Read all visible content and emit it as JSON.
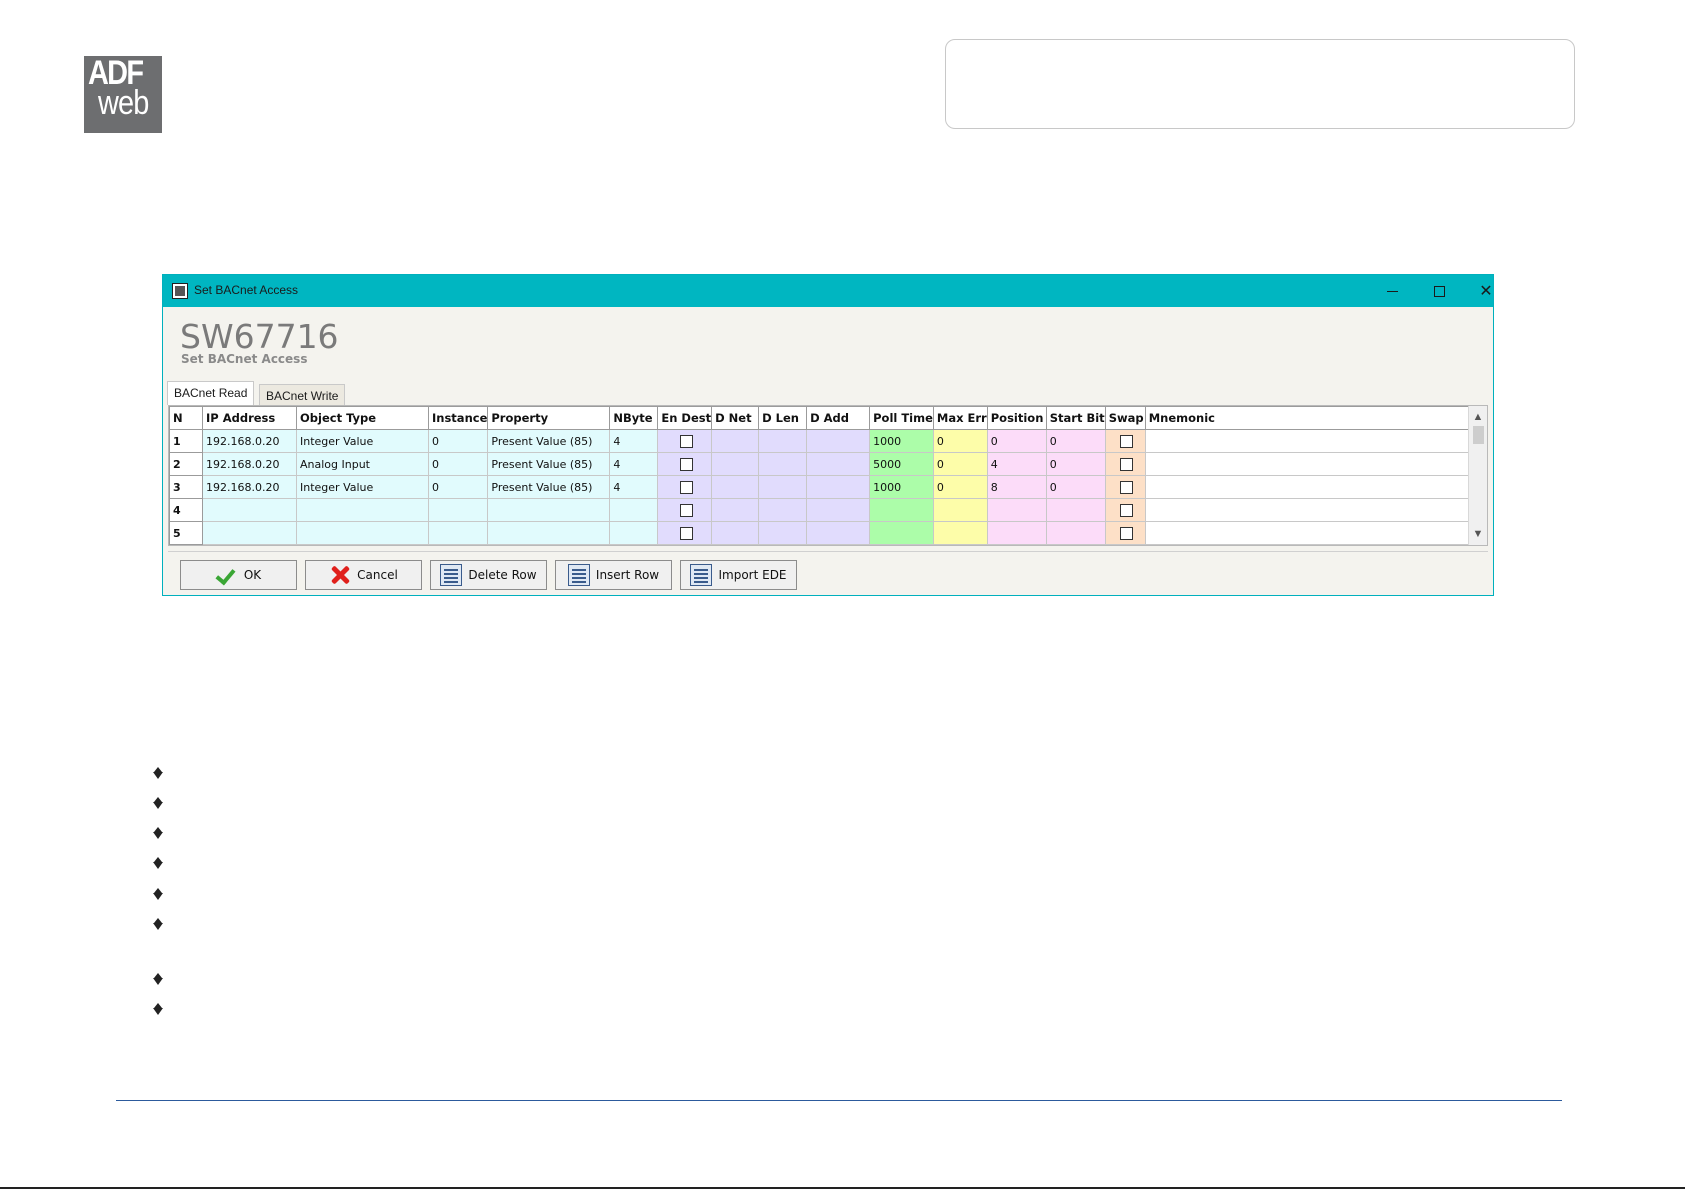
{
  "logo": {
    "top": "ADF",
    "bottom": "web"
  },
  "window": {
    "title": "Set BACnet Access",
    "heading": "SW67716",
    "subheading": "Set BACnet Access",
    "tabs": [
      "BACnet Read",
      "BACnet Write"
    ],
    "columns": [
      "N",
      "IP Address",
      "Object Type",
      "Instance",
      "Property",
      "NByte",
      "En Dest",
      "D Net",
      "D Len",
      "D Add",
      "Poll Time",
      "Max Err",
      "Position",
      "Start Bit",
      "Swap",
      "Mnemonic"
    ],
    "rows": [
      {
        "n": "1",
        "ip": "192.168.0.20",
        "object_type": "Integer Value",
        "instance": "0",
        "property": "Present Value (85)",
        "nbyte": "4",
        "d_net": "",
        "d_len": "",
        "d_add": "",
        "poll_time": "1000",
        "max_err": "0",
        "position": "0",
        "start_bit": "0",
        "mnemonic": ""
      },
      {
        "n": "2",
        "ip": "192.168.0.20",
        "object_type": "Analog Input",
        "instance": "0",
        "property": "Present Value (85)",
        "nbyte": "4",
        "d_net": "",
        "d_len": "",
        "d_add": "",
        "poll_time": "5000",
        "max_err": "0",
        "position": "4",
        "start_bit": "0",
        "mnemonic": ""
      },
      {
        "n": "3",
        "ip": "192.168.0.20",
        "object_type": "Integer Value",
        "instance": "0",
        "property": "Present Value (85)",
        "nbyte": "4",
        "d_net": "",
        "d_len": "",
        "d_add": "",
        "poll_time": "1000",
        "max_err": "0",
        "position": "8",
        "start_bit": "0",
        "mnemonic": ""
      },
      {
        "n": "4",
        "ip": "",
        "object_type": "",
        "instance": "",
        "property": "",
        "nbyte": "",
        "d_net": "",
        "d_len": "",
        "d_add": "",
        "poll_time": "",
        "max_err": "",
        "position": "",
        "start_bit": "",
        "mnemonic": ""
      },
      {
        "n": "5",
        "ip": "",
        "object_type": "",
        "instance": "",
        "property": "",
        "nbyte": "",
        "d_net": "",
        "d_len": "",
        "d_add": "",
        "poll_time": "",
        "max_err": "",
        "position": "",
        "start_bit": "",
        "mnemonic": ""
      }
    ],
    "buttons": {
      "ok": "OK",
      "cancel": "Cancel",
      "delete_row": "Delete Row",
      "insert_row": "Insert Row",
      "import_ede": "Import EDE"
    }
  },
  "colors": {
    "titlebar": "#00b6c1",
    "cyan_cols": "#e1fbfd",
    "lavender_cols": "#e1dcfd",
    "poll_time": "#acfda9",
    "max_err": "#fdfda9",
    "pink_cols": "#fcdcf9",
    "swap": "#fde0c7"
  },
  "icons": {
    "ok": "check-icon",
    "cancel": "x-icon",
    "delete_row": "delete-row-icon",
    "insert_row": "insert-row-icon",
    "import_ede": "list-icon",
    "bullet": "bullet-arrow-icon"
  }
}
